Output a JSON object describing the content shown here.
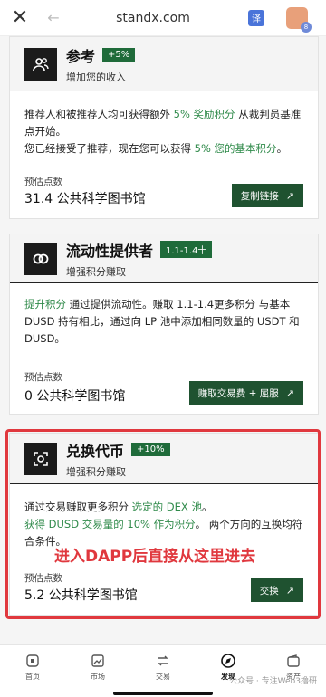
{
  "browser": {
    "url": "standx.com",
    "translate_label": "译",
    "avatar_count": "8"
  },
  "cards": [
    {
      "title": "参考",
      "badge": "+5%",
      "subtitle": "增加您的收入",
      "desc": [
        {
          "text": "推荐人和被推荐人均可获得额外 ",
          "green": false
        },
        {
          "text": "5% 奖励积分",
          "green": true
        },
        {
          "text": " 从裁判员基准点开始。",
          "green": false
        }
      ],
      "desc2": [
        {
          "text": "您已经接受了推荐，现在您可以获得 ",
          "green": false
        },
        {
          "text": "5% 您的基本积分",
          "green": true
        },
        {
          "text": "。",
          "green": false
        }
      ],
      "est_label": "预估点数",
      "est_value": "31.4 公共科学图书馆",
      "button": "复制链接"
    },
    {
      "title": "流动性提供者",
      "badge": "1.1-1.4十",
      "subtitle": "增强积分赚取",
      "desc": [
        {
          "text": "提升积分",
          "green": true
        },
        {
          "text": " 通过提供流动性。赚取 1.1-1.4更多积分 与基本 DUSD 持有相比，通过向 LP 池中添加相同数量的 USDT 和 DUSD。",
          "green": false
        }
      ],
      "est_label": "预估点数",
      "est_value": "0 公共科学图书馆",
      "button": "赚取交易费 + 屈服"
    },
    {
      "title": "兑换代币",
      "badge": "+10%",
      "subtitle": "增强积分赚取",
      "desc": [
        {
          "text": "通过交易赚取更多积分 ",
          "green": false
        },
        {
          "text": "选定的 DEX 池",
          "green": true
        },
        {
          "text": "。",
          "green": false
        }
      ],
      "desc2": [
        {
          "text": "获得 DUSD 交易量的 10% 作为积分",
          "green": true
        },
        {
          "text": "。 两个方向的互换均符合条件。",
          "green": false
        }
      ],
      "est_label": "预估点数",
      "est_value": "5.2 公共科学图书馆",
      "button": "交换"
    }
  ],
  "annotation": "进入DAPP后直接从这里进去",
  "nav": [
    {
      "label": "首页",
      "icon": "home-icon"
    },
    {
      "label": "市场",
      "icon": "market-icon"
    },
    {
      "label": "交易",
      "icon": "trade-icon"
    },
    {
      "label": "发现",
      "icon": "discover-icon"
    },
    {
      "label": "资产",
      "icon": "wallet-icon"
    }
  ],
  "watermark": "公众号 · 专注Web3撸研",
  "colors": {
    "accent_green": "#1f5230",
    "badge_green": "#1f6b3a",
    "text_green": "#2f8a4a",
    "highlight_red": "#e0383e"
  }
}
